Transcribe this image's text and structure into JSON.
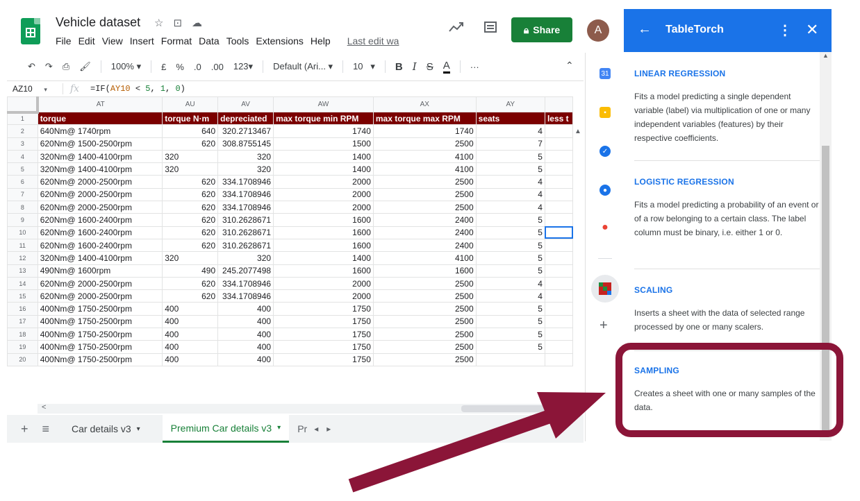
{
  "app": {
    "doc_title": "Vehicle dataset",
    "last_edit": "Last edit wa",
    "share_label": "Share",
    "avatar_initial": "A"
  },
  "menu": [
    "File",
    "Edit",
    "View",
    "Insert",
    "Format",
    "Data",
    "Tools",
    "Extensions",
    "Help"
  ],
  "toolbar": {
    "zoom": "100%",
    "currency": "£",
    "percent": "%",
    "dec_decrease": ".0",
    "dec_increase": ".00",
    "number_format": "123",
    "font": "Default (Ari...",
    "font_size": "10",
    "bold": "B",
    "italic": "I",
    "strike": "S",
    "text_color": "A",
    "more": "···"
  },
  "formula_bar": {
    "cell_ref": "AZ10",
    "fx": "fx",
    "formula_prefix": "=IF(",
    "formula_ref": "AY10",
    "formula_op": " < ",
    "formula_a": "5",
    "formula_sep1": ", ",
    "formula_b": "1",
    "formula_sep2": ", ",
    "formula_c": "0",
    "formula_suffix": ")"
  },
  "sheet": {
    "columns": [
      "AT",
      "AU",
      "AV",
      "AW",
      "AX",
      "AY",
      ""
    ],
    "header_row_number": "1",
    "headers": [
      "torque",
      "torque N·m",
      "depreciated",
      "max torque min RPM",
      "max torque max RPM",
      "seats",
      "less t"
    ],
    "rows": [
      {
        "n": "2",
        "cells": [
          "640Nm@ 1740rpm",
          "640",
          "320.2713467",
          "1740",
          "1740",
          "4",
          ""
        ]
      },
      {
        "n": "3",
        "cells": [
          "620Nm@ 1500-2500rpm",
          "620",
          "308.8755145",
          "1500",
          "2500",
          "7",
          ""
        ]
      },
      {
        "n": "4",
        "cells": [
          "320Nm@ 1400-4100rpm",
          "320",
          "320",
          "1400",
          "4100",
          "5",
          ""
        ]
      },
      {
        "n": "5",
        "cells": [
          "320Nm@ 1400-4100rpm",
          "320",
          "320",
          "1400",
          "4100",
          "5",
          ""
        ]
      },
      {
        "n": "6",
        "cells": [
          "620Nm@ 2000-2500rpm",
          "620",
          "334.1708946",
          "2000",
          "2500",
          "4",
          ""
        ]
      },
      {
        "n": "7",
        "cells": [
          "620Nm@ 2000-2500rpm",
          "620",
          "334.1708946",
          "2000",
          "2500",
          "4",
          ""
        ]
      },
      {
        "n": "8",
        "cells": [
          "620Nm@ 2000-2500rpm",
          "620",
          "334.1708946",
          "2000",
          "2500",
          "4",
          ""
        ]
      },
      {
        "n": "9",
        "cells": [
          "620Nm@ 1600-2400rpm",
          "620",
          "310.2628671",
          "1600",
          "2400",
          "5",
          ""
        ]
      },
      {
        "n": "10",
        "cells": [
          "620Nm@ 1600-2400rpm",
          "620",
          "310.2628671",
          "1600",
          "2400",
          "5",
          ""
        ]
      },
      {
        "n": "11",
        "cells": [
          "620Nm@ 1600-2400rpm",
          "620",
          "310.2628671",
          "1600",
          "2400",
          "5",
          ""
        ]
      },
      {
        "n": "12",
        "cells": [
          "320Nm@ 1400-4100rpm",
          "320",
          "320",
          "1400",
          "4100",
          "5",
          ""
        ]
      },
      {
        "n": "13",
        "cells": [
          "490Nm@ 1600rpm",
          "490",
          "245.2077498",
          "1600",
          "1600",
          "5",
          ""
        ]
      },
      {
        "n": "14",
        "cells": [
          "620Nm@ 2000-2500rpm",
          "620",
          "334.1708946",
          "2000",
          "2500",
          "4",
          ""
        ]
      },
      {
        "n": "15",
        "cells": [
          "620Nm@ 2000-2500rpm",
          "620",
          "334.1708946",
          "2000",
          "2500",
          "4",
          ""
        ]
      },
      {
        "n": "16",
        "cells": [
          "400Nm@ 1750-2500rpm",
          "400",
          "400",
          "1750",
          "2500",
          "5",
          ""
        ]
      },
      {
        "n": "17",
        "cells": [
          "400Nm@ 1750-2500rpm",
          "400",
          "400",
          "1750",
          "2500",
          "5",
          ""
        ]
      },
      {
        "n": "18",
        "cells": [
          "400Nm@ 1750-2500rpm",
          "400",
          "400",
          "1750",
          "2500",
          "5",
          ""
        ]
      },
      {
        "n": "19",
        "cells": [
          "400Nm@ 1750-2500rpm",
          "400",
          "400",
          "1750",
          "2500",
          "5",
          ""
        ]
      },
      {
        "n": "20",
        "cells": [
          "400Nm@ 1750-2500rpm",
          "400",
          "400",
          "1750",
          "2500",
          "",
          ""
        ]
      }
    ],
    "selected_row": "10",
    "selected_col_index": 6,
    "header_row_color": "#7b0000"
  },
  "tabs": {
    "items": [
      {
        "label": "Car details v3",
        "active": false
      },
      {
        "label": "Premium Car details v3",
        "active": true
      },
      {
        "label": "Pr",
        "active": false
      }
    ]
  },
  "panel": {
    "title": "TableTorch",
    "sections": [
      {
        "title": "LINEAR REGRESSION",
        "desc": "Fits a model predicting a single dependent variable (label) via multiplication of one or many independent variables (features) by their respective coefficients."
      },
      {
        "title": "LOGISTIC REGRESSION",
        "desc": "Fits a model predicting a probability of an event or of a row belonging to a certain class. The label column must be binary, i.e. either 1 or 0."
      },
      {
        "title": "SCALING",
        "desc": "Inserts a sheet with the data of selected range processed by one or many scalers."
      },
      {
        "title": "SAMPLING",
        "desc": "Creates a sheet with one or many samples of the data."
      }
    ],
    "accent_color": "#1a73e8"
  },
  "annotation": {
    "highlight_color": "#8b1538"
  }
}
